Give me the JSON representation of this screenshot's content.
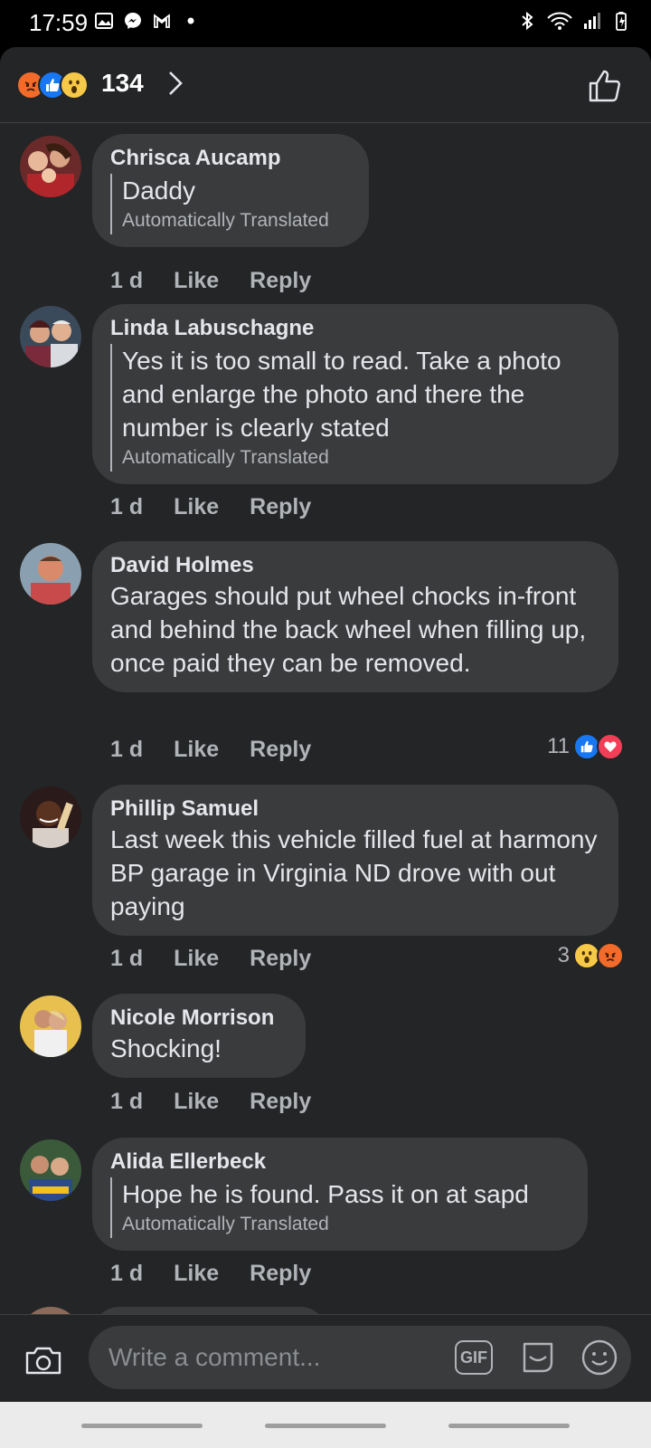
{
  "status_bar": {
    "time": "17:59",
    "left_icons": [
      "gallery-icon",
      "messenger-icon",
      "gmail-icon",
      "dot-icon"
    ],
    "right_icons": [
      "bluetooth-icon",
      "wifi-icon",
      "signal-icon",
      "battery-icon"
    ]
  },
  "header": {
    "reaction_types": [
      "angry",
      "like",
      "wow"
    ],
    "reaction_count": "134"
  },
  "comments": [
    {
      "author": "Chrisca Aucamp",
      "text": "Daddy",
      "translated": true,
      "translated_note": "Automatically Translated",
      "time": "1 d",
      "like_label": "Like",
      "reply_label": "Reply",
      "reactions": null
    },
    {
      "author": "Linda Labuschagne",
      "text": "Yes it is too small to read. Take a photo and enlarge the photo and there the number is clearly stated",
      "translated": true,
      "translated_note": "Automatically Translated",
      "time": "1 d",
      "like_label": "Like",
      "reply_label": "Reply",
      "reactions": null
    },
    {
      "author": "David Holmes",
      "text": "Garages should put wheel chocks in-front and behind the back wheel when filling up, once paid they can be removed.",
      "translated": false,
      "time": "1 d",
      "like_label": "Like",
      "reply_label": "Reply",
      "reactions": {
        "count": "11",
        "types": [
          "like",
          "love"
        ]
      }
    },
    {
      "author": "Phillip Samuel",
      "text": "Last week this  vehicle filled fuel at harmony BP garage in Virginia ND drove with out paying",
      "translated": false,
      "time": "1 d",
      "like_label": "Like",
      "reply_label": "Reply",
      "reactions": {
        "count": "3",
        "types": [
          "wow",
          "angry"
        ]
      }
    },
    {
      "author": "Nicole Morrison",
      "text": "Shocking!",
      "translated": false,
      "time": "1 d",
      "like_label": "Like",
      "reply_label": "Reply",
      "reactions": null
    },
    {
      "author": "Alida Ellerbeck",
      "text": "Hope he is found. Pass it on at sapd",
      "translated": true,
      "translated_note": "Automatically Translated",
      "time": "1 d",
      "like_label": "Like",
      "reply_label": "Reply",
      "reactions": null
    }
  ],
  "composer": {
    "placeholder": "Write a comment...",
    "gif_label": "GIF"
  },
  "colors": {
    "background": "#242526",
    "bubble": "#3a3b3c",
    "text": "#e4e6eb",
    "muted": "#b0b3b8",
    "like_blue": "#1877f2",
    "love_red": "#f33e58"
  }
}
